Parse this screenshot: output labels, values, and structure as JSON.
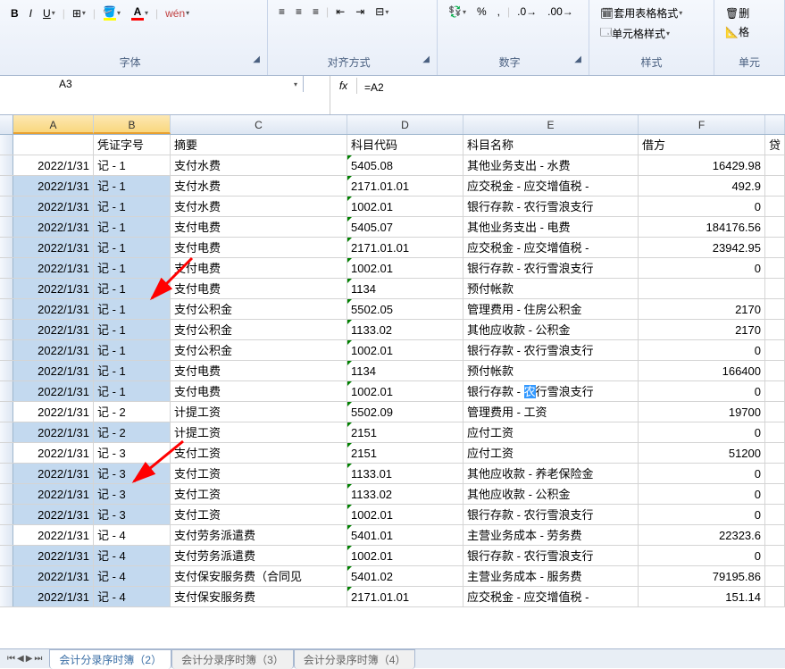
{
  "ribbon": {
    "font_group": "字体",
    "align_group": "对齐方式",
    "number_group": "数字",
    "style_group": "样式",
    "cell_group": "单元",
    "format_table": "套用表格格式",
    "cell_styles": "单元格样式",
    "delete_btn": "删",
    "format_btn": "格",
    "bold": "B",
    "italic": "I",
    "underline": "U",
    "font_literal": "A",
    "wen_btn": "wén"
  },
  "name_box": "A3",
  "fx": "fx",
  "formula": "=A2",
  "headers": {
    "A": "A",
    "B": "B",
    "C": "C",
    "D": "D",
    "E": "E",
    "F": "F"
  },
  "row1": {
    "B": "凭证字号",
    "C": "摘要",
    "D": "科目代码",
    "E": "科目名称",
    "F": "借方",
    "G": "贷"
  },
  "rows": [
    {
      "A": "2022/1/31",
      "B": "记 - 1",
      "C": "支付水费",
      "D": "5405.08",
      "E": "其他业务支出 - 水费",
      "F": "16429.98",
      "hl": false
    },
    {
      "A": "2022/1/31",
      "B": "记 - 1",
      "C": "支付水费",
      "D": "2171.01.01",
      "E": "应交税金 - 应交增值税 -",
      "F": "492.9",
      "hl": true
    },
    {
      "A": "2022/1/31",
      "B": "记 - 1",
      "C": "支付水费",
      "D": "1002.01",
      "E": "银行存款 - 农行雪浪支行",
      "F": "0",
      "hl": true
    },
    {
      "A": "2022/1/31",
      "B": "记 - 1",
      "C": "支付电费",
      "D": "5405.07",
      "E": "其他业务支出 - 电费",
      "F": "184176.56",
      "hl": true
    },
    {
      "A": "2022/1/31",
      "B": "记 - 1",
      "C": "支付电费",
      "D": "2171.01.01",
      "E": "应交税金 - 应交增值税 -",
      "F": "23942.95",
      "hl": true
    },
    {
      "A": "2022/1/31",
      "B": "记 - 1",
      "C": "支付电费",
      "D": "1002.01",
      "E": "银行存款 - 农行雪浪支行",
      "F": "0",
      "hl": true
    },
    {
      "A": "2022/1/31",
      "B": "记 - 1",
      "C": "支付电费",
      "D": "1134",
      "E": "预付帐款",
      "F": "",
      "hl": true
    },
    {
      "A": "2022/1/31",
      "B": "记 - 1",
      "C": "支付公积金",
      "D": "5502.05",
      "E": "管理费用 - 住房公积金",
      "F": "2170",
      "hl": true
    },
    {
      "A": "2022/1/31",
      "B": "记 - 1",
      "C": "支付公积金",
      "D": "1133.02",
      "E": "其他应收款 - 公积金",
      "F": "2170",
      "hl": true
    },
    {
      "A": "2022/1/31",
      "B": "记 - 1",
      "C": "支付公积金",
      "D": "1002.01",
      "E": "银行存款 - 农行雪浪支行",
      "F": "0",
      "hl": true
    },
    {
      "A": "2022/1/31",
      "B": "记 - 1",
      "C": "支付电费",
      "D": "1134",
      "E": "预付帐款",
      "F": "166400",
      "hl": true
    },
    {
      "A": "2022/1/31",
      "B": "记 - 1",
      "C": "支付电费",
      "D": "1002.01",
      "E": "银行存款 - 农行雪浪支行",
      "F": "0",
      "hl": true,
      "eSel": "农"
    },
    {
      "A": "2022/1/31",
      "B": "记 - 2",
      "C": "计提工资",
      "D": "5502.09",
      "E": "管理费用 - 工资",
      "F": "19700",
      "hl": false
    },
    {
      "A": "2022/1/31",
      "B": "记 - 2",
      "C": "计提工资",
      "D": "2151",
      "E": "应付工资",
      "F": "0",
      "hl": true
    },
    {
      "A": "2022/1/31",
      "B": "记 - 3",
      "C": "支付工资",
      "D": "2151",
      "E": "应付工资",
      "F": "51200",
      "hl": false
    },
    {
      "A": "2022/1/31",
      "B": "记 - 3",
      "C": "支付工资",
      "D": "1133.01",
      "E": "其他应收款 - 养老保险金",
      "F": "0",
      "hl": true
    },
    {
      "A": "2022/1/31",
      "B": "记 - 3",
      "C": "支付工资",
      "D": "1133.02",
      "E": "其他应收款 - 公积金",
      "F": "0",
      "hl": true
    },
    {
      "A": "2022/1/31",
      "B": "记 - 3",
      "C": "支付工资",
      "D": "1002.01",
      "E": "银行存款 - 农行雪浪支行",
      "F": "0",
      "hl": true
    },
    {
      "A": "2022/1/31",
      "B": "记 - 4",
      "C": "支付劳务派遣费",
      "D": "5401.01",
      "E": "主营业务成本 - 劳务费",
      "F": "22323.6",
      "hl": false
    },
    {
      "A": "2022/1/31",
      "B": "记 - 4",
      "C": "支付劳务派遣费",
      "D": "1002.01",
      "E": "银行存款 - 农行雪浪支行",
      "F": "0",
      "hl": true
    },
    {
      "A": "2022/1/31",
      "B": "记 - 4",
      "C": "支付保安服务费（合同见",
      "D": "5401.02",
      "E": "主营业务成本 - 服务费",
      "F": "79195.86",
      "hl": true
    },
    {
      "A": "2022/1/31",
      "B": "记 - 4",
      "C": "支付保安服务费",
      "D": "2171.01.01",
      "E": "应交税金 - 应交增值税 -",
      "F": "151.14",
      "hl": true
    }
  ],
  "tabs": {
    "t1": "会计分录序时簿（2）",
    "t2": "会计分录序时簿（3）",
    "t3": "会计分录序时簿（4）"
  }
}
